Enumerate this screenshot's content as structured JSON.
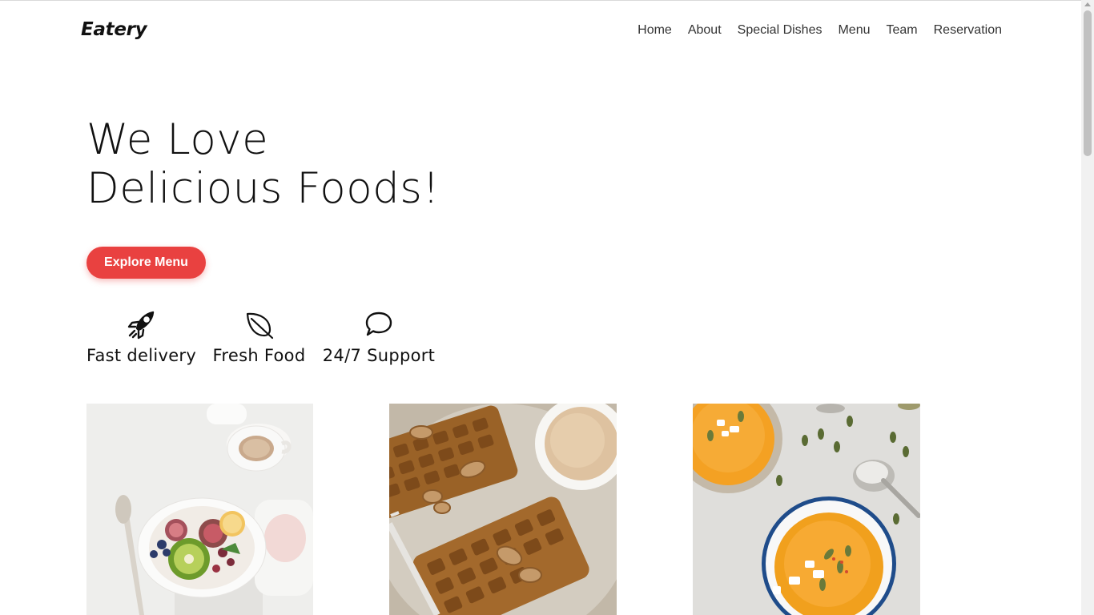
{
  "brand": {
    "name": "Eatery"
  },
  "nav": {
    "items": [
      {
        "label": "Home"
      },
      {
        "label": "About"
      },
      {
        "label": "Special Dishes"
      },
      {
        "label": "Menu"
      },
      {
        "label": "Team"
      },
      {
        "label": "Reservation"
      }
    ]
  },
  "hero": {
    "title_line1": "We Love",
    "title_line2": "Delicious Foods!",
    "cta_label": "Explore Menu"
  },
  "features": [
    {
      "icon": "rocket-icon",
      "label": "Fast delivery"
    },
    {
      "icon": "leaf-icon",
      "label": "Fresh Food"
    },
    {
      "icon": "speech-bubble-icon",
      "label": "24/7 Support"
    }
  ],
  "gallery": [
    {
      "icon": "fruit-bowl-photo"
    },
    {
      "icon": "waffles-photo"
    },
    {
      "icon": "pumpkin-soup-photo"
    }
  ],
  "colors": {
    "accent": "#e94140",
    "text": "#111111",
    "nav_text": "#333333",
    "background": "#ffffff"
  }
}
